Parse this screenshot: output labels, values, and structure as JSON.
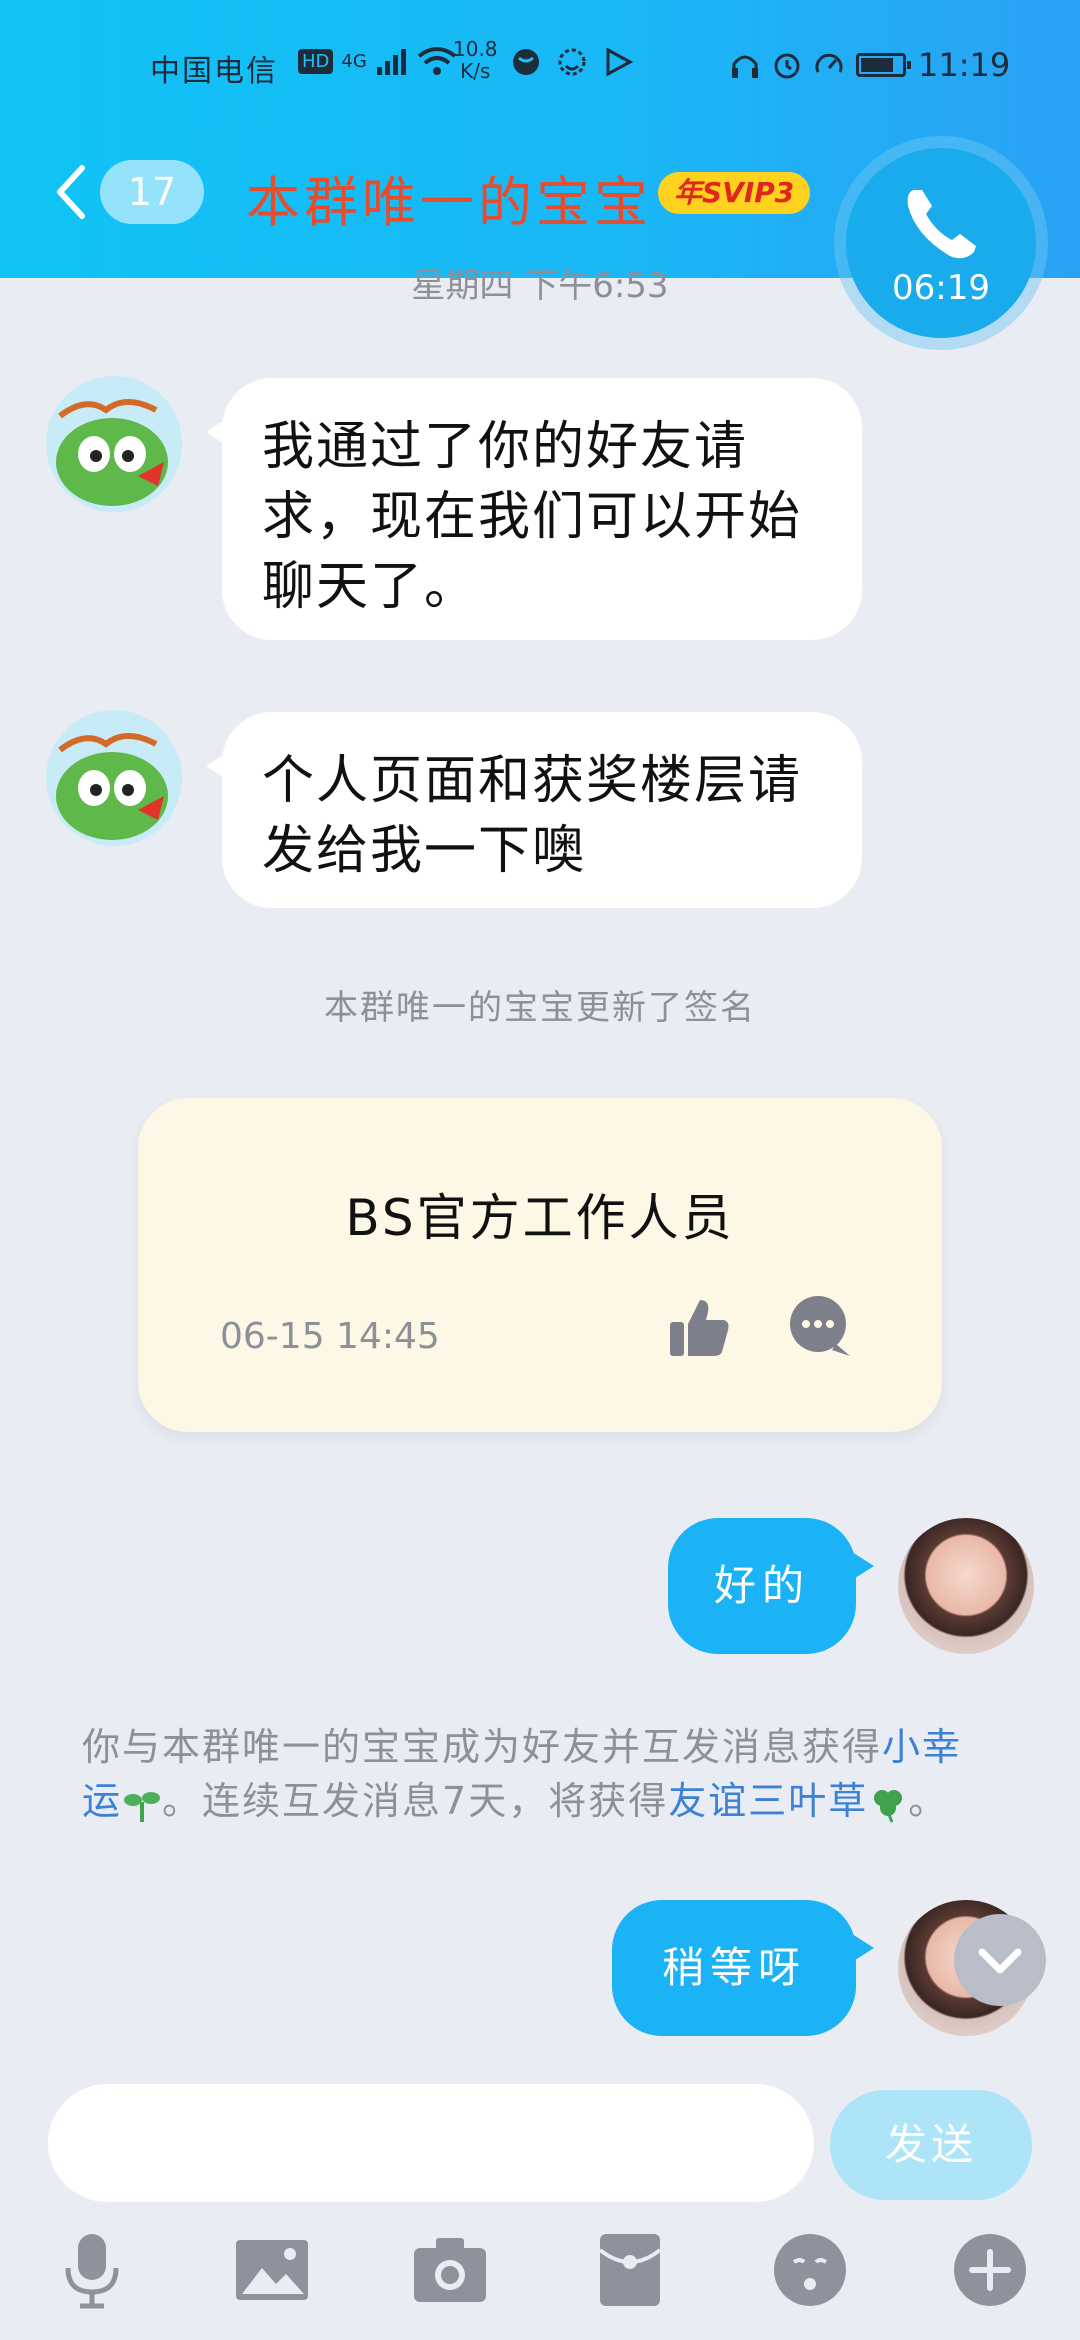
{
  "status_bar": {
    "carrier": "中国电信",
    "hd_label": "HD",
    "network_type": "4G",
    "speed_value": "10.8",
    "speed_unit": "K/s",
    "time": "11:19"
  },
  "header": {
    "unread_count": "17",
    "title": "本群唯一的宝宝",
    "vip_badge": "年SVIP3"
  },
  "call": {
    "duration": "06:19"
  },
  "messages": {
    "timestamp_top": "星期四 下午6:53",
    "left_1": "我通过了你的好友请求，现在我们可以开始聊天了。",
    "left_2": "个人页面和获奖楼层请发给我一下噢",
    "system_update": "本群唯一的宝宝更新了签名",
    "signature_text": "BS官方工作人员",
    "signature_time": "06-15 14:45",
    "right_1": "好的",
    "friend_tip_pre": "你与本群唯一的宝宝成为好友并互发消息获得",
    "friend_tip_link1": "小幸运",
    "friend_tip_mid": "。连续互发消息7天，将获得",
    "friend_tip_link2": "友谊三叶草",
    "friend_tip_end": "。",
    "right_2": "稍等呀"
  },
  "input": {
    "send_label": "发送"
  },
  "colors": {
    "accent": "#1bb3f5",
    "title_red": "#e74c2c",
    "link": "#3b82d6"
  },
  "icons": [
    "back-arrow",
    "phone",
    "thumbs-up",
    "comment",
    "chevron-down",
    "microphone",
    "image",
    "camera",
    "red-packet",
    "emoji",
    "plus"
  ]
}
